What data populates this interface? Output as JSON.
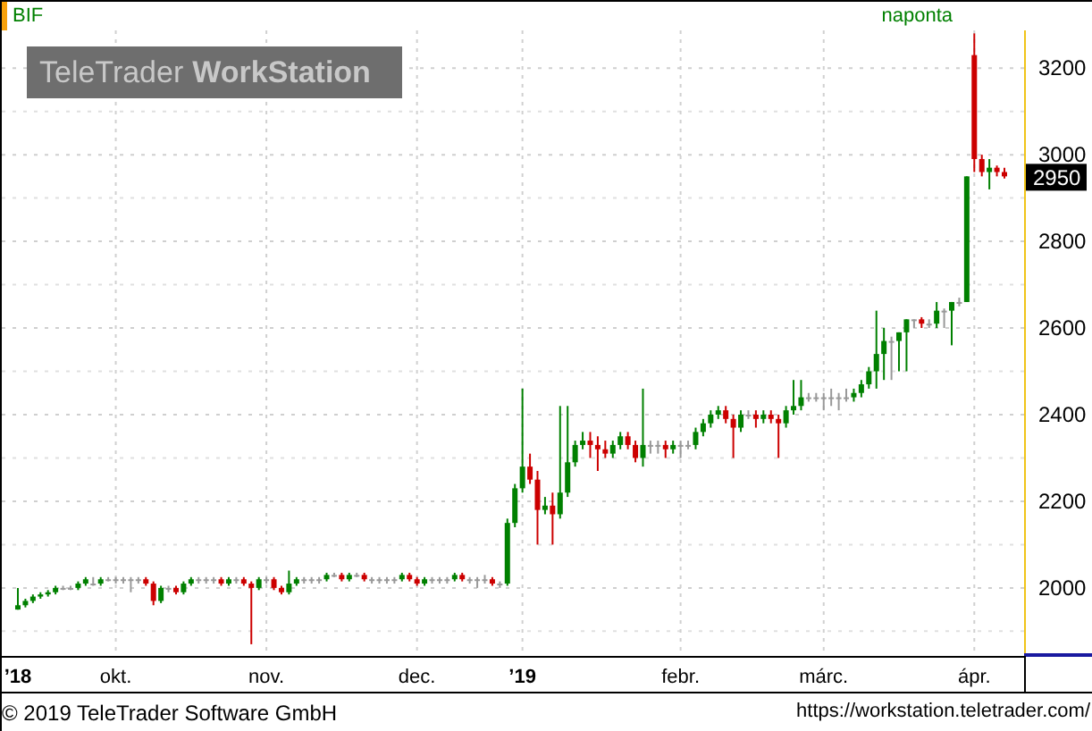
{
  "header": {
    "symbol": "BIF",
    "interval": "naponta"
  },
  "logo": {
    "part_1": "TeleTrader",
    "part_2": "WorkStation"
  },
  "chart": {
    "last_price": "2950",
    "chart_data": {
      "type": "candlestick",
      "grid": true,
      "ylim": [
        1843,
        3287
      ],
      "yticks": [
        2000,
        2200,
        2400,
        2600,
        2800,
        3000,
        3200
      ],
      "categories": [
        "’18",
        null,
        null,
        null,
        null,
        null,
        null,
        null,
        null,
        null,
        null,
        null,
        null,
        "okt.",
        null,
        null,
        null,
        null,
        null,
        null,
        null,
        null,
        null,
        null,
        null,
        null,
        null,
        null,
        null,
        null,
        null,
        null,
        null,
        "nov.",
        null,
        null,
        null,
        null,
        null,
        null,
        null,
        null,
        null,
        null,
        null,
        null,
        null,
        null,
        null,
        null,
        null,
        null,
        null,
        "dec.",
        null,
        null,
        null,
        null,
        null,
        null,
        null,
        null,
        null,
        null,
        null,
        null,
        null,
        "’19",
        null,
        null,
        null,
        null,
        null,
        null,
        null,
        null,
        null,
        null,
        null,
        null,
        null,
        null,
        null,
        null,
        null,
        null,
        null,
        null,
        "febr.",
        null,
        null,
        null,
        null,
        null,
        null,
        null,
        null,
        null,
        null,
        null,
        null,
        null,
        null,
        null,
        null,
        null,
        null,
        "márc.",
        null,
        null,
        null,
        null,
        null,
        null,
        null,
        null,
        null,
        null,
        null,
        null,
        null,
        null,
        null,
        null,
        null,
        null,
        null,
        "ápr.",
        null,
        null,
        null,
        null
      ],
      "ohlc": [
        [
          1950,
          2000,
          1950,
          1960
        ],
        [
          1960,
          1975,
          1955,
          1970
        ],
        [
          1970,
          1985,
          1965,
          1980
        ],
        [
          1980,
          1990,
          1975,
          1985
        ],
        [
          1985,
          1995,
          1980,
          1990
        ],
        [
          1990,
          2005,
          1985,
          2000
        ],
        [
          2000,
          2005,
          1995,
          2000
        ],
        [
          2000,
          2005,
          1995,
          2000
        ],
        [
          2000,
          2015,
          1995,
          2010
        ],
        [
          2010,
          2025,
          2005,
          2020
        ],
        [
          2010,
          2025,
          2005,
          2010
        ],
        [
          2010,
          2025,
          2005,
          2020
        ],
        [
          2020,
          2025,
          2015,
          2020
        ],
        [
          2020,
          2025,
          2010,
          2020
        ],
        [
          2020,
          2025,
          2010,
          2020
        ],
        [
          2020,
          2025,
          1990,
          2020
        ],
        [
          2020,
          2025,
          2010,
          2020
        ],
        [
          2020,
          2025,
          2005,
          2010
        ],
        [
          2010,
          2015,
          1960,
          1970
        ],
        [
          1970,
          2005,
          1965,
          2000
        ],
        [
          2000,
          2005,
          1990,
          2000
        ],
        [
          2000,
          2005,
          1985,
          1990
        ],
        [
          1990,
          2015,
          1985,
          2010
        ],
        [
          2010,
          2025,
          2005,
          2020
        ],
        [
          2020,
          2025,
          2010,
          2020
        ],
        [
          2020,
          2025,
          2010,
          2020
        ],
        [
          2020,
          2025,
          2010,
          2020
        ],
        [
          2020,
          2025,
          2005,
          2010
        ],
        [
          2010,
          2025,
          2005,
          2020
        ],
        [
          2020,
          2025,
          2010,
          2020
        ],
        [
          2020,
          2025,
          2005,
          2010
        ],
        [
          2010,
          2015,
          1870,
          2000
        ],
        [
          2000,
          2025,
          1995,
          2020
        ],
        [
          2020,
          2025,
          2010,
          2020
        ],
        [
          2020,
          2025,
          1995,
          2000
        ],
        [
          2000,
          2005,
          1985,
          1990
        ],
        [
          1990,
          2040,
          1985,
          2010
        ],
        [
          2010,
          2025,
          2005,
          2020
        ],
        [
          2020,
          2025,
          2010,
          2020
        ],
        [
          2020,
          2025,
          2010,
          2020
        ],
        [
          2020,
          2025,
          2010,
          2020
        ],
        [
          2020,
          2035,
          2015,
          2030
        ],
        [
          2030,
          2035,
          2025,
          2030
        ],
        [
          2030,
          2035,
          2015,
          2020
        ],
        [
          2020,
          2035,
          2015,
          2030
        ],
        [
          2030,
          2035,
          2025,
          2030
        ],
        [
          2030,
          2035,
          2015,
          2020
        ],
        [
          2020,
          2025,
          2010,
          2020
        ],
        [
          2020,
          2025,
          2010,
          2020
        ],
        [
          2020,
          2025,
          2010,
          2020
        ],
        [
          2020,
          2025,
          2010,
          2020
        ],
        [
          2020,
          2035,
          2015,
          2030
        ],
        [
          2030,
          2035,
          2015,
          2020
        ],
        [
          2020,
          2025,
          2005,
          2010
        ],
        [
          2010,
          2025,
          2005,
          2020
        ],
        [
          2020,
          2025,
          2010,
          2020
        ],
        [
          2020,
          2025,
          2010,
          2020
        ],
        [
          2020,
          2025,
          2010,
          2020
        ],
        [
          2020,
          2035,
          2015,
          2030
        ],
        [
          2030,
          2035,
          2015,
          2020
        ],
        [
          2020,
          2025,
          2010,
          2020
        ],
        [
          2020,
          2025,
          2000,
          2020
        ],
        [
          2020,
          2030,
          2010,
          2020
        ],
        [
          2020,
          2025,
          2005,
          2010
        ],
        [
          2010,
          2015,
          2000,
          2010
        ],
        [
          2010,
          2160,
          2005,
          2150
        ],
        [
          2150,
          2240,
          2140,
          2230
        ],
        [
          2230,
          2460,
          2220,
          2280
        ],
        [
          2280,
          2310,
          2240,
          2250
        ],
        [
          2250,
          2270,
          2100,
          2180
        ],
        [
          2180,
          2210,
          2170,
          2190
        ],
        [
          2190,
          2220,
          2100,
          2170
        ],
        [
          2170,
          2420,
          2160,
          2220
        ],
        [
          2220,
          2420,
          2210,
          2290
        ],
        [
          2290,
          2340,
          2280,
          2330
        ],
        [
          2330,
          2360,
          2320,
          2340
        ],
        [
          2340,
          2360,
          2300,
          2330
        ],
        [
          2330,
          2350,
          2270,
          2320
        ],
        [
          2320,
          2340,
          2300,
          2310
        ],
        [
          2310,
          2340,
          2300,
          2330
        ],
        [
          2330,
          2360,
          2320,
          2350
        ],
        [
          2350,
          2360,
          2320,
          2330
        ],
        [
          2330,
          2340,
          2290,
          2300
        ],
        [
          2300,
          2460,
          2280,
          2330
        ],
        [
          2330,
          2340,
          2310,
          2330
        ],
        [
          2330,
          2340,
          2310,
          2330
        ],
        [
          2330,
          2340,
          2300,
          2320
        ],
        [
          2320,
          2340,
          2310,
          2330
        ],
        [
          2330,
          2340,
          2300,
          2330
        ],
        [
          2330,
          2340,
          2320,
          2330
        ],
        [
          2330,
          2370,
          2320,
          2360
        ],
        [
          2360,
          2390,
          2350,
          2380
        ],
        [
          2380,
          2410,
          2370,
          2400
        ],
        [
          2400,
          2420,
          2390,
          2410
        ],
        [
          2410,
          2420,
          2380,
          2390
        ],
        [
          2390,
          2400,
          2300,
          2370
        ],
        [
          2370,
          2410,
          2360,
          2400
        ],
        [
          2400,
          2410,
          2390,
          2400
        ],
        [
          2400,
          2410,
          2370,
          2390
        ],
        [
          2390,
          2410,
          2380,
          2400
        ],
        [
          2400,
          2410,
          2380,
          2390
        ],
        [
          2390,
          2400,
          2300,
          2380
        ],
        [
          2380,
          2420,
          2370,
          2410
        ],
        [
          2410,
          2480,
          2400,
          2420
        ],
        [
          2420,
          2480,
          2410,
          2440
        ],
        [
          2440,
          2450,
          2430,
          2440
        ],
        [
          2440,
          2450,
          2430,
          2440
        ],
        [
          2440,
          2450,
          2410,
          2440
        ],
        [
          2440,
          2460,
          2420,
          2440
        ],
        [
          2440,
          2450,
          2410,
          2440
        ],
        [
          2440,
          2460,
          2430,
          2440
        ],
        [
          2440,
          2460,
          2430,
          2450
        ],
        [
          2450,
          2480,
          2440,
          2470
        ],
        [
          2470,
          2510,
          2460,
          2500
        ],
        [
          2500,
          2640,
          2460,
          2540
        ],
        [
          2540,
          2600,
          2480,
          2570
        ],
        [
          2570,
          2580,
          2480,
          2570
        ],
        [
          2570,
          2590,
          2500,
          2590
        ],
        [
          2590,
          2620,
          2500,
          2620
        ],
        [
          2620,
          2620,
          2600,
          2620
        ],
        [
          2620,
          2625,
          2600,
          2610
        ],
        [
          2610,
          2620,
          2600,
          2610
        ],
        [
          2610,
          2660,
          2600,
          2640
        ],
        [
          2640,
          2645,
          2600,
          2640
        ],
        [
          2640,
          2660,
          2560,
          2660
        ],
        [
          2660,
          2670,
          2650,
          2660
        ],
        [
          2660,
          2950,
          2660,
          2950
        ],
        [
          3230,
          3280,
          2960,
          2990
        ],
        [
          2990,
          3000,
          2950,
          2960
        ],
        [
          2960,
          2990,
          2920,
          2970
        ],
        [
          2970,
          2975,
          2950,
          2960
        ],
        [
          2960,
          2970,
          2945,
          2950
        ]
      ]
    }
  },
  "footer": {
    "copyright": "© 2019 TeleTrader Software GmbH",
    "url": "https://workstation.teletrader.com/"
  }
}
